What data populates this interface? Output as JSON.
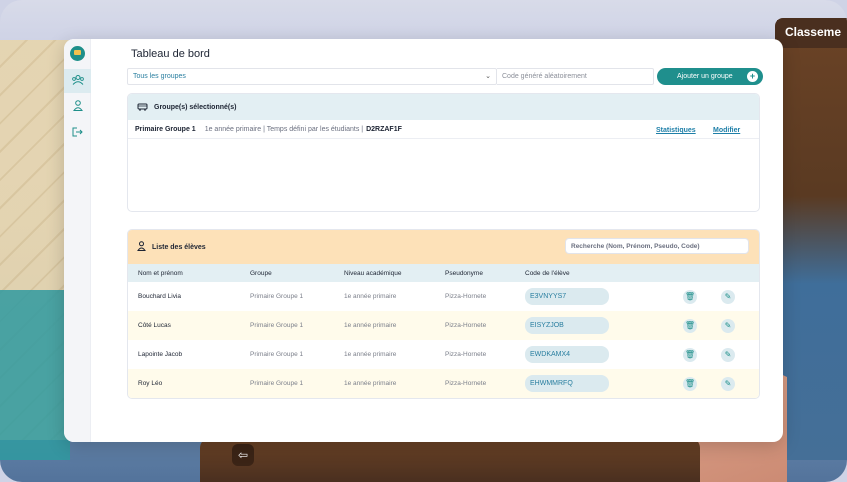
{
  "backdrop": {
    "panel_title": "Classeme"
  },
  "sidebar": {
    "items": [
      {
        "name": "groups",
        "icon": "groups-icon"
      },
      {
        "name": "profile",
        "icon": "user-icon"
      },
      {
        "name": "logout",
        "icon": "logout-icon"
      }
    ]
  },
  "header": {
    "title": "Tableau de bord",
    "group_select_value": "Tous les groupes",
    "code_placeholder": "Code généré aléatoirement",
    "add_button": "Ajouter un groupe"
  },
  "selected": {
    "title": "Groupe(s) sélectionné(s)",
    "group_name": "Primaire Groupe 1",
    "group_desc": "1e année primaire | Temps défini par les étudiants |",
    "group_code": "D2RZAF1F",
    "stats_link": "Statistiques",
    "edit_link": "Modifier"
  },
  "students": {
    "title": "Liste des élèves",
    "search_placeholder": "Recherche (Nom, Prénom, Pseudo, Code)",
    "columns": [
      "Nom et prénom",
      "Groupe",
      "Niveau académique",
      "Pseudonyme",
      "Code de l'élève"
    ],
    "rows": [
      {
        "name": "Bouchard Livia",
        "group": "Primaire Groupe 1",
        "level": "1e année primaire",
        "pseudo": "Pizza-Hornete",
        "code": "E3VNYYS7"
      },
      {
        "name": "Côté Lucas",
        "group": "Primaire Groupe 1",
        "level": "1e année primaire",
        "pseudo": "Pizza-Hornete",
        "code": "EISYZJOB"
      },
      {
        "name": "Lapointe Jacob",
        "group": "Primaire Groupe 1",
        "level": "1e année primaire",
        "pseudo": "Pizza-Hornete",
        "code": "EWDKAMX4"
      },
      {
        "name": "Roy Léo",
        "group": "Primaire Groupe 1",
        "level": "1e année primaire",
        "pseudo": "Pizza-Hornete",
        "code": "EHWMMRFQ"
      }
    ]
  },
  "colors": {
    "accent": "#1f8f8d",
    "link": "#1e7fa8",
    "selected_header": "#e3eff3",
    "students_header": "#fde1b8"
  }
}
